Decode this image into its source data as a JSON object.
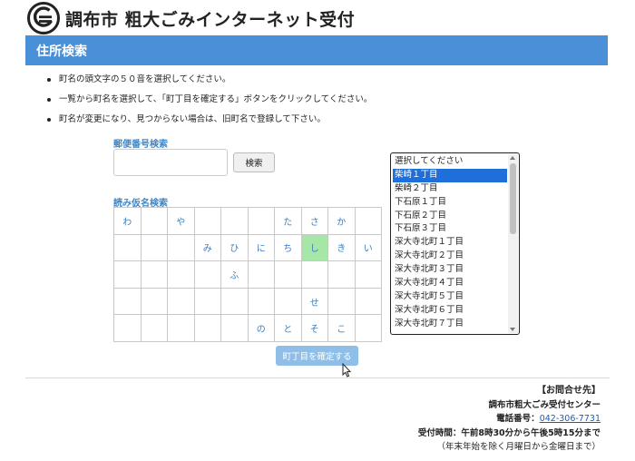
{
  "header": {
    "title": "調布市 粗大ごみインターネット受付",
    "logo_color": "#222222"
  },
  "section": {
    "title": "住所検索",
    "bar_color": "#4a90d9"
  },
  "instructions": [
    "町名の頭文字の５０音を選択してください。",
    "一覧から町名を選択して、「町丁目を確定する」ボタンをクリックしてください。",
    "町名が変更になり、見つからない場合は、旧町名で登録して下さい。"
  ],
  "postal_search": {
    "label": "郵便番号検索",
    "input_value": "",
    "button_label": "検索"
  },
  "kana_search": {
    "label": "読み仮名検索",
    "active_color": "#a6e6a6",
    "rows": [
      [
        "わ",
        "",
        "や",
        "",
        "",
        "",
        "た",
        "さ",
        "か",
        ""
      ],
      [
        "",
        "",
        "",
        "み",
        "ひ",
        "に",
        "ち",
        "し",
        "き",
        "い"
      ],
      [
        "",
        "",
        "",
        "",
        "ふ",
        "",
        "",
        "",
        "",
        ""
      ],
      [
        "",
        "",
        "",
        "",
        "",
        "",
        "",
        "せ",
        "",
        ""
      ],
      [
        "",
        "",
        "",
        "",
        "",
        "の",
        "と",
        "そ",
        "こ",
        ""
      ]
    ],
    "active": "し"
  },
  "town_select": {
    "options": [
      "選択してください",
      "柴崎１丁目",
      "柴崎２丁目",
      "下石原１丁目",
      "下石原２丁目",
      "下石原３丁目",
      "深大寺北町１丁目",
      "深大寺北町２丁目",
      "深大寺北町３丁目",
      "深大寺北町４丁目",
      "深大寺北町５丁目",
      "深大寺北町６丁目",
      "深大寺北町７丁目"
    ],
    "selected_index": 1
  },
  "confirm_button": {
    "label": "町丁目を確定する"
  },
  "contact": {
    "title": "【お問合せ先】",
    "center": "調布市粗大ごみ受付センター",
    "phone_label": "電話番号：",
    "phone": "042-306-7731",
    "hours": "受付時間：午前8時30分から午後5時15分まで",
    "note": "（年末年始を除く月曜日から金曜日まで）"
  }
}
